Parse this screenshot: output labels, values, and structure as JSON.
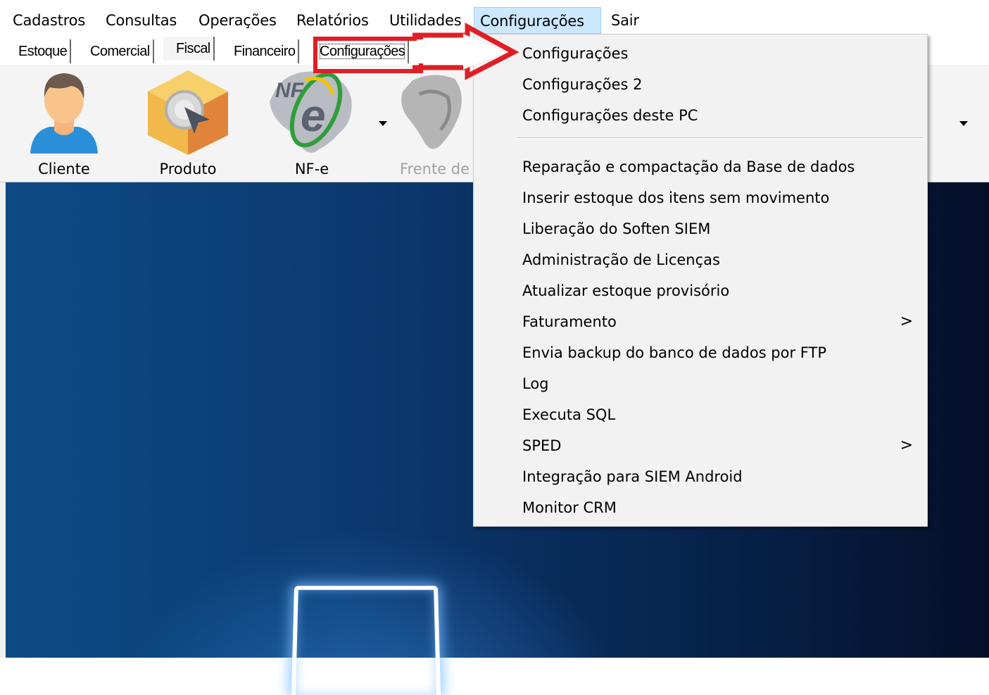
{
  "menubar": {
    "items": [
      "Cadastros",
      "Consultas",
      "Operações",
      "Relatórios",
      "Utilidades",
      "Configurações",
      "Sair"
    ]
  },
  "tabs": [
    "Estoque",
    "Comercial",
    "Fiscal",
    "Financeiro",
    "Configurações"
  ],
  "toolbar": {
    "tools": [
      {
        "label": "Cliente",
        "icon": "person-icon"
      },
      {
        "label": "Produto",
        "icon": "product-box-icon"
      },
      {
        "label": "NF-e",
        "icon": "nfe-icon"
      },
      {
        "label": "Frente de",
        "icon": "map-icon"
      }
    ]
  },
  "dropdown": {
    "items": [
      {
        "label": "Configurações"
      },
      {
        "label": "Configurações 2"
      },
      {
        "label": "Configurações deste PC"
      },
      {
        "label": "Reparação e compactação da Base de dados"
      },
      {
        "label": "Inserir estoque dos itens sem movimento"
      },
      {
        "label": "Liberação do Soften SIEM"
      },
      {
        "label": "Administração de Licenças"
      },
      {
        "label": "Atualizar estoque provisório"
      },
      {
        "label": "Faturamento",
        "submenu": ">"
      },
      {
        "label": "Envia backup do banco de dados por FTP"
      },
      {
        "label": "Log"
      },
      {
        "label": "Executa SQL"
      },
      {
        "label": "SPED",
        "submenu": ">"
      },
      {
        "label": "Integração para SIEM Android"
      },
      {
        "label": "Monitor CRM"
      }
    ]
  },
  "colors": {
    "menu_highlight": "#cce8ff",
    "annotation_arrow": "#e01e25",
    "desktop": "#0b3a70"
  }
}
